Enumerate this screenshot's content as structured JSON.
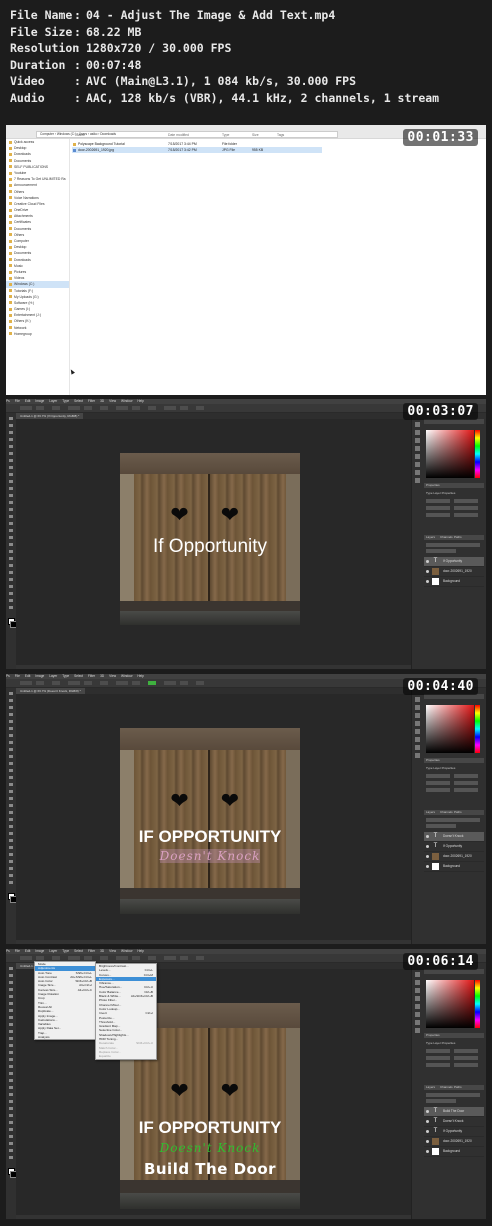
{
  "info": {
    "rows": [
      {
        "label": "File Name",
        "value": "04 - Adjust The Image & Add Text.mp4"
      },
      {
        "label": "File Size",
        "value": "68.22 MB"
      },
      {
        "label": "Resolution",
        "value": "1280x720 / 30.000 FPS"
      },
      {
        "label": "Duration",
        "value": "00:07:48"
      },
      {
        "label": "Video",
        "value": "AVC (Main@L3.1), 1 084 kb/s, 30.000 FPS"
      },
      {
        "label": "Audio",
        "value": "AAC, 128 kb/s (VBR), 44.1 kHz, 2 channels, 1 stream"
      }
    ],
    "separator": ":"
  },
  "panels": [
    {
      "timestamp": "00:01:33"
    },
    {
      "timestamp": "00:03:07"
    },
    {
      "timestamp": "00:04:40"
    },
    {
      "timestamp": "00:06:14"
    }
  ],
  "explorer": {
    "breadcrumb": "Computer › Windows (C:) › Users › asiko › Downloads",
    "sidebar": [
      "Quick access",
      "Desktop",
      "Downloads",
      "Documents",
      "SELF PUBLICATIONS",
      "Youtube",
      "7 Reasons To Get UNLIMITED Ra",
      "Announcement",
      "Others",
      "Voice Narrations",
      "Creative Cloud Files",
      "OneDrive",
      "Attachments",
      "Certificates",
      "Documents",
      "Others",
      "Computer",
      "Desktop",
      "Documents",
      "Downloads",
      "Music",
      "Pictures",
      "Videos",
      "Windows (C:)",
      "Tutorials (F:)",
      "My Uploads (G:)",
      "Software (H:)",
      "Games (I:)",
      "Entertainment (J:)",
      "Others (K:)",
      "Network",
      "Homegroup"
    ],
    "sidebar_selected": 23,
    "columns": [
      "Name",
      "Date modified",
      "Type",
      "Size",
      "Tags"
    ],
    "files": [
      {
        "name": "Polyscape Background Tutorial",
        "date": "7/15/2017 3:44 PM",
        "type": "File folder",
        "size": ""
      },
      {
        "name": "door-2002691_1920.jpg",
        "date": "7/15/2017 3:42 PM",
        "type": "JPG File",
        "size": "955 KB"
      }
    ]
  },
  "photoshop": {
    "menu": [
      "Ps",
      "File",
      "Edit",
      "Image",
      "Layer",
      "Type",
      "Select",
      "Filter",
      "3D",
      "View",
      "Window",
      "Help"
    ],
    "tab_title_2": "Untitled-1 @ 66.7% (If Opportunity, RGB/8) *",
    "tab_title_3": "Untitled-1 @ 66.7% (Doesn't Knock, RGB/8) *",
    "tab_title_4": "Untitled-1 @ 66.7% (Build The Door, RGB/8) *",
    "panel_tabs": [
      "Layers",
      "Channels",
      "Paths"
    ],
    "properties_title": "Properties",
    "type_layer_props": "Type Layer Properties",
    "layers_2": [
      "If Opportunity",
      "door-2002691_1920",
      "Background"
    ],
    "layers_3": [
      "Doesn't Knock",
      "If Opportunity",
      "door-2002691_1920",
      "Background"
    ],
    "layers_4": [
      "Build The Door",
      "Doesn't Knock",
      "If Opportunity",
      "door-2002691_1920",
      "Background"
    ]
  },
  "artwork": {
    "text_2": "If Opportunity",
    "text_3a": "IF OPPORTUNITY",
    "text_3b": "Doesn't Knock",
    "text_4a": "IF OPPORTUNITY",
    "text_4b": "Doesn't Knock",
    "text_4c": "Build The Door",
    "heart": "❤",
    "colors": {
      "white": "#ffffff",
      "pink": "#d9a0c0",
      "green": "#2fbf2f"
    }
  },
  "image_menu": [
    {
      "label": "Mode",
      "shortcut": ""
    },
    {
      "label": "Adjustments",
      "shortcut": "",
      "highlight": true
    },
    {
      "label": "Auto Tone",
      "shortcut": "Shift+Ctrl+L"
    },
    {
      "label": "Auto Contrast",
      "shortcut": "Alt+Shift+Ctrl+L"
    },
    {
      "label": "Auto Color",
      "shortcut": "Shift+Ctrl+B"
    },
    {
      "label": "Image Size...",
      "shortcut": "Alt+Ctrl+I"
    },
    {
      "label": "Canvas Size...",
      "shortcut": "Alt+Ctrl+C"
    },
    {
      "label": "Image Rotation",
      "shortcut": ""
    },
    {
      "label": "Crop",
      "shortcut": ""
    },
    {
      "label": "Trim...",
      "shortcut": ""
    },
    {
      "label": "Reveal All",
      "shortcut": ""
    },
    {
      "label": "Duplicate...",
      "shortcut": ""
    },
    {
      "label": "Apply Image...",
      "shortcut": ""
    },
    {
      "label": "Calculations...",
      "shortcut": ""
    },
    {
      "label": "Variables",
      "shortcut": ""
    },
    {
      "label": "Apply Data Set...",
      "shortcut": ""
    },
    {
      "label": "Trap...",
      "shortcut": ""
    },
    {
      "label": "Analysis",
      "shortcut": ""
    }
  ],
  "adjust_menu": [
    {
      "label": "Brightness/Contrast...",
      "shortcut": ""
    },
    {
      "label": "Levels...",
      "shortcut": "Ctrl+L"
    },
    {
      "label": "Curves...",
      "shortcut": "Ctrl+M"
    },
    {
      "label": "Exposure...",
      "shortcut": "",
      "highlight": true
    },
    {
      "label": "Vibrance...",
      "shortcut": ""
    },
    {
      "label": "Hue/Saturation...",
      "shortcut": "Ctrl+U"
    },
    {
      "label": "Color Balance...",
      "shortcut": "Ctrl+B"
    },
    {
      "label": "Black & White...",
      "shortcut": "Alt+Shift+Ctrl+B"
    },
    {
      "label": "Photo Filter...",
      "shortcut": ""
    },
    {
      "label": "Channel Mixer...",
      "shortcut": ""
    },
    {
      "label": "Color Lookup...",
      "shortcut": ""
    },
    {
      "label": "Invert",
      "shortcut": "Ctrl+I"
    },
    {
      "label": "Posterize...",
      "shortcut": ""
    },
    {
      "label": "Threshold...",
      "shortcut": ""
    },
    {
      "label": "Gradient Map...",
      "shortcut": ""
    },
    {
      "label": "Selective Color...",
      "shortcut": ""
    },
    {
      "label": "Shadows/Highlights...",
      "shortcut": ""
    },
    {
      "label": "HDR Toning...",
      "shortcut": ""
    },
    {
      "label": "Desaturate",
      "shortcut": "Shift+Ctrl+U"
    },
    {
      "label": "Match Color...",
      "shortcut": ""
    },
    {
      "label": "Replace Color...",
      "shortcut": ""
    },
    {
      "label": "Equalize",
      "shortcut": ""
    }
  ]
}
